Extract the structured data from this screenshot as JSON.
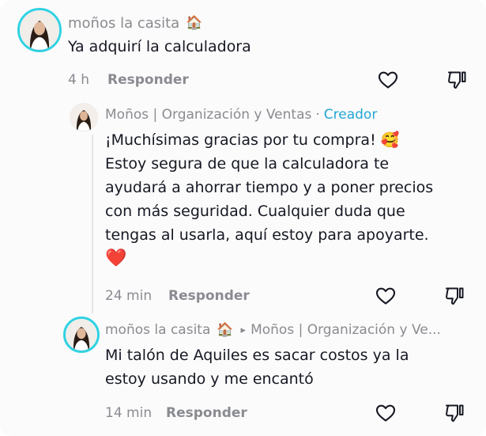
{
  "comments": [
    {
      "username": "moños la casita",
      "username_emoji": "🏠",
      "text": "Ya adquirí la calculadora",
      "time": "4 h",
      "reply_label": "Responder"
    },
    {
      "username": "Moños | Organización y Ventas",
      "separator": "·",
      "badge": "Creador",
      "text_lines": [
        "¡Muchísimas gracias por tu compra! 🥰",
        "Estoy segura de que la calculadora te",
        "ayudará a ahorrar tiempo y a poner precios",
        "con más seguridad. Cualquier duda que",
        "tengas al usarla, aquí estoy para apoyarte.",
        "❤️"
      ],
      "time": "24 min",
      "reply_label": "Responder"
    },
    {
      "username": "moños la casita",
      "username_emoji": "🏠",
      "reply_arrow": "▸",
      "reply_to": "Moños | Organización y Ve...",
      "text_lines": [
        "Mi talón de Aquiles es sacar costos ya la",
        "estoy usando y me encantó"
      ],
      "time": "14 min",
      "reply_label": "Responder"
    }
  ],
  "icons": {
    "like": "heart-outline-icon",
    "dislike": "thumbs-down-outline-icon"
  },
  "colors": {
    "text": "#161823",
    "muted": "#8a8b91",
    "creator_badge": "#24a5d6",
    "avatar_ring": "#2fd2e3"
  }
}
